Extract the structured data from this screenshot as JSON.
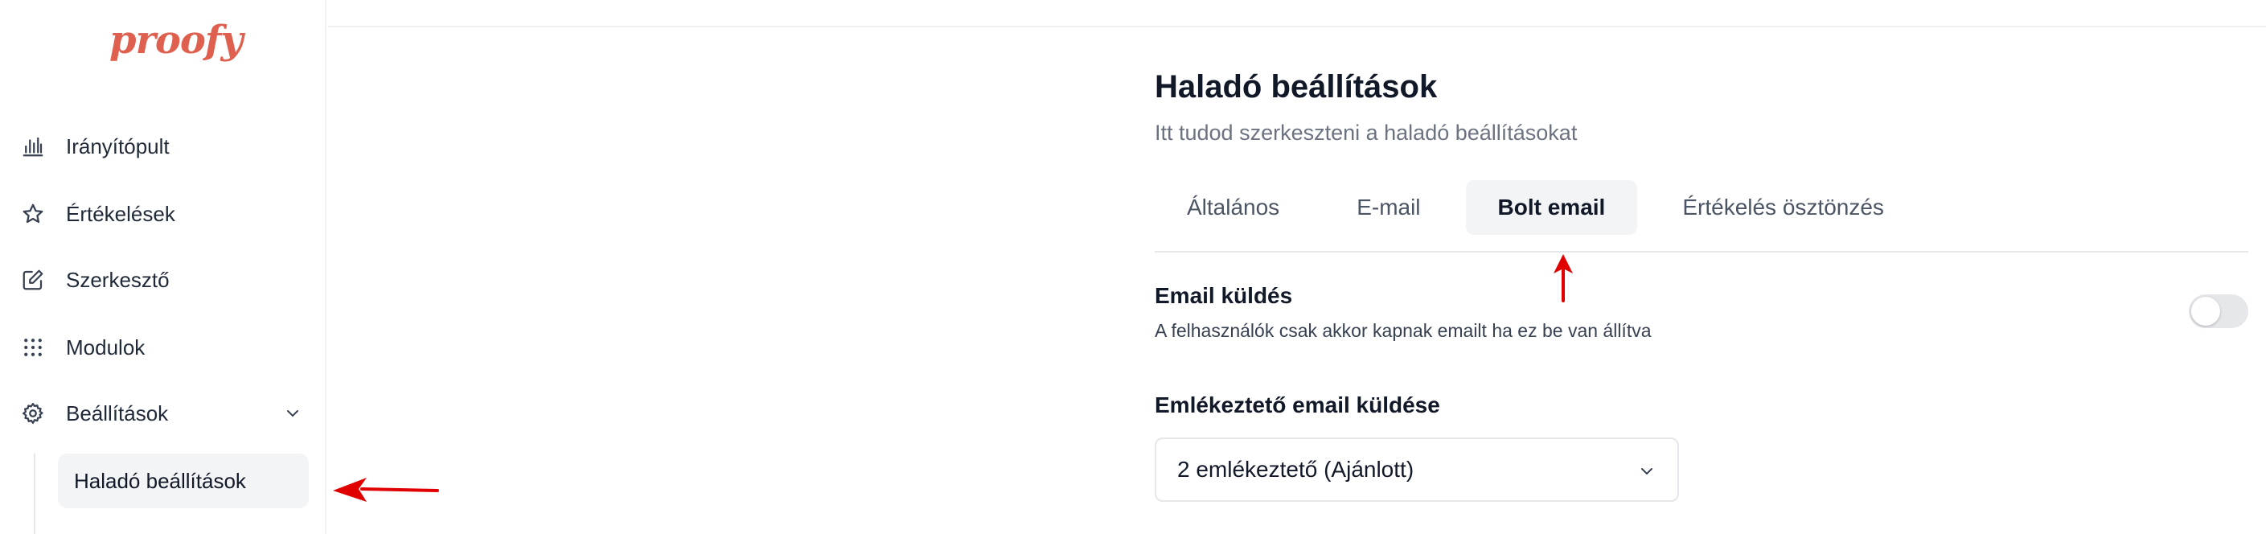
{
  "brand": {
    "logo_text": "proofy",
    "color": "#e0604f"
  },
  "sidebar": {
    "items": [
      {
        "label": "Irányítópult",
        "icon": "bar-chart-icon"
      },
      {
        "label": "Értékelések",
        "icon": "star-icon"
      },
      {
        "label": "Szerkesztő",
        "icon": "edit-icon"
      },
      {
        "label": "Modulok",
        "icon": "grid-dots-icon"
      },
      {
        "label": "Beállítások",
        "icon": "gear-icon",
        "expanded": true
      }
    ],
    "sub_items": [
      {
        "label": "Haladó beállítások",
        "active": true
      }
    ]
  },
  "main": {
    "title": "Haladó beállítások",
    "subtitle": "Itt tudod szerkeszteni a haladó beállításokat",
    "tabs": [
      {
        "label": "Általános",
        "active": false
      },
      {
        "label": "E-mail",
        "active": false
      },
      {
        "label": "Bolt email",
        "active": true
      },
      {
        "label": "Értékelés ösztönzés",
        "active": false
      }
    ],
    "email_sending": {
      "title": "Email küldés",
      "description": "A felhasználók csak akkor kapnak emailt ha ez be van állítva",
      "enabled": false
    },
    "reminder": {
      "label": "Emlékeztető email küldése",
      "selected": "2 emlékeztető (Ajánlott)"
    }
  },
  "annotation_color": "#e00000"
}
